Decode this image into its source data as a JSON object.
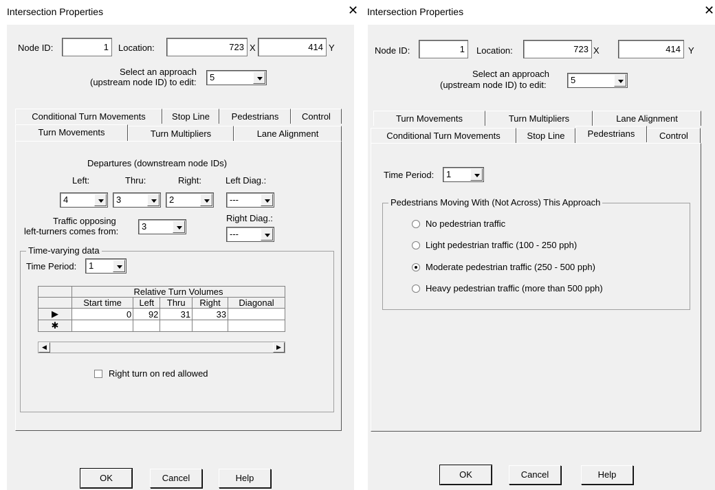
{
  "left": {
    "title": "Intersection Properties",
    "node_id_label": "Node ID:",
    "node_id": "1",
    "location_label": "Location:",
    "x_value": "723",
    "x_label": "X",
    "y_value": "414",
    "y_label": "Y",
    "approach_label_1": "Select an approach",
    "approach_label_2": "(upstream node ID) to edit:",
    "approach_value": "5",
    "tabs_back": [
      "Conditional Turn Movements",
      "Stop Line",
      "Pedestrians",
      "Control"
    ],
    "tabs_front": [
      "Turn Movements",
      "Turn Multipliers",
      "Lane Alignment"
    ],
    "departures_label": "Departures (downstream node IDs)",
    "left_label": "Left:",
    "thru_label": "Thru:",
    "right_label": "Right:",
    "left_diag_label": "Left Diag.:",
    "left_val": "4",
    "thru_val": "3",
    "right_val": "2",
    "left_diag_val": "---",
    "opposing_label_1": "Traffic opposing",
    "opposing_label_2": "left-turners comes from:",
    "opposing_val": "3",
    "right_diag_label": "Right Diag.:",
    "right_diag_val": "---",
    "time_varying_label": "Time-varying data",
    "time_period_label": "Time Period:",
    "time_period_val": "1",
    "grid_title": "Relative Turn Volumes",
    "grid_cols": [
      "Start time",
      "Left",
      "Thru",
      "Right",
      "Diagonal"
    ],
    "grid_row": [
      "0",
      "92",
      "31",
      "33",
      ""
    ],
    "rtor_label": "Right turn on red allowed",
    "ok": "OK",
    "cancel": "Cancel",
    "help": "Help"
  },
  "right": {
    "title": "Intersection Properties",
    "node_id_label": "Node ID:",
    "node_id": "1",
    "location_label": "Location:",
    "x_value": "723",
    "x_label": "X",
    "y_value": "414",
    "y_label": "Y",
    "approach_label_1": "Select an approach",
    "approach_label_2": "(upstream node ID) to edit:",
    "approach_value": "5",
    "tabs_back": [
      "Turn Movements",
      "Turn Multipliers",
      "Lane Alignment"
    ],
    "tabs_front": [
      "Conditional Turn Movements",
      "Stop Line",
      "Pedestrians",
      "Control"
    ],
    "time_period_label": "Time Period:",
    "time_period_val": "1",
    "ped_group_label": "Pedestrians Moving With (Not Across) This Approach",
    "ped_options": [
      "No pedestrian traffic",
      "Light pedestrian traffic (100 - 250 pph)",
      "Moderate pedestrian traffic  (250 - 500 pph)",
      "Heavy pedestrian traffic  (more than 500 pph)"
    ],
    "ped_selected": "Moderate pedestrian traffic  (250 - 500 pph)",
    "ok": "OK",
    "cancel": "Cancel",
    "help": "Help"
  },
  "close_glyph": "✕"
}
